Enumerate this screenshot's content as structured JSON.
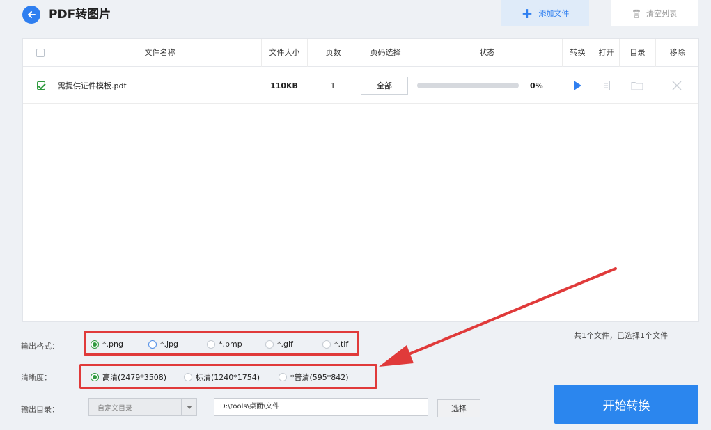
{
  "header": {
    "title": "PDF转图片",
    "add_files_label": "添加文件",
    "clear_list_label": "清空列表"
  },
  "table": {
    "columns": [
      "文件名称",
      "文件大小",
      "页数",
      "页码选择",
      "状态",
      "转换",
      "打开",
      "目录",
      "移除"
    ],
    "rows": [
      {
        "checked": true,
        "name": "需提供证件模板.pdf",
        "size": "110KB",
        "pages": "1",
        "page_select": "全部",
        "progress": 0,
        "progress_text": "0%"
      }
    ]
  },
  "summary": "共1个文件，已选择1个文件",
  "output_format": {
    "label": "输出格式：",
    "options": [
      "*.png",
      "*.jpg",
      "*.bmp",
      "*.gif",
      "*.tif"
    ],
    "selected": "*.png"
  },
  "quality": {
    "label": "清晰度：",
    "options": [
      "高清(2479*3508)",
      "标清(1240*1754)",
      "*普清(595*842)"
    ],
    "selected": "高清(2479*3508)"
  },
  "output_dir": {
    "label": "输出目录：",
    "mode": "自定义目录",
    "path": "D:\\tools\\桌面\\文件",
    "choose_label": "选择"
  },
  "start_label": "开始转换",
  "colors": {
    "accent": "#2f7ff0",
    "annotation": "#e03a3a",
    "selected_radio": "#2f9a3f"
  }
}
